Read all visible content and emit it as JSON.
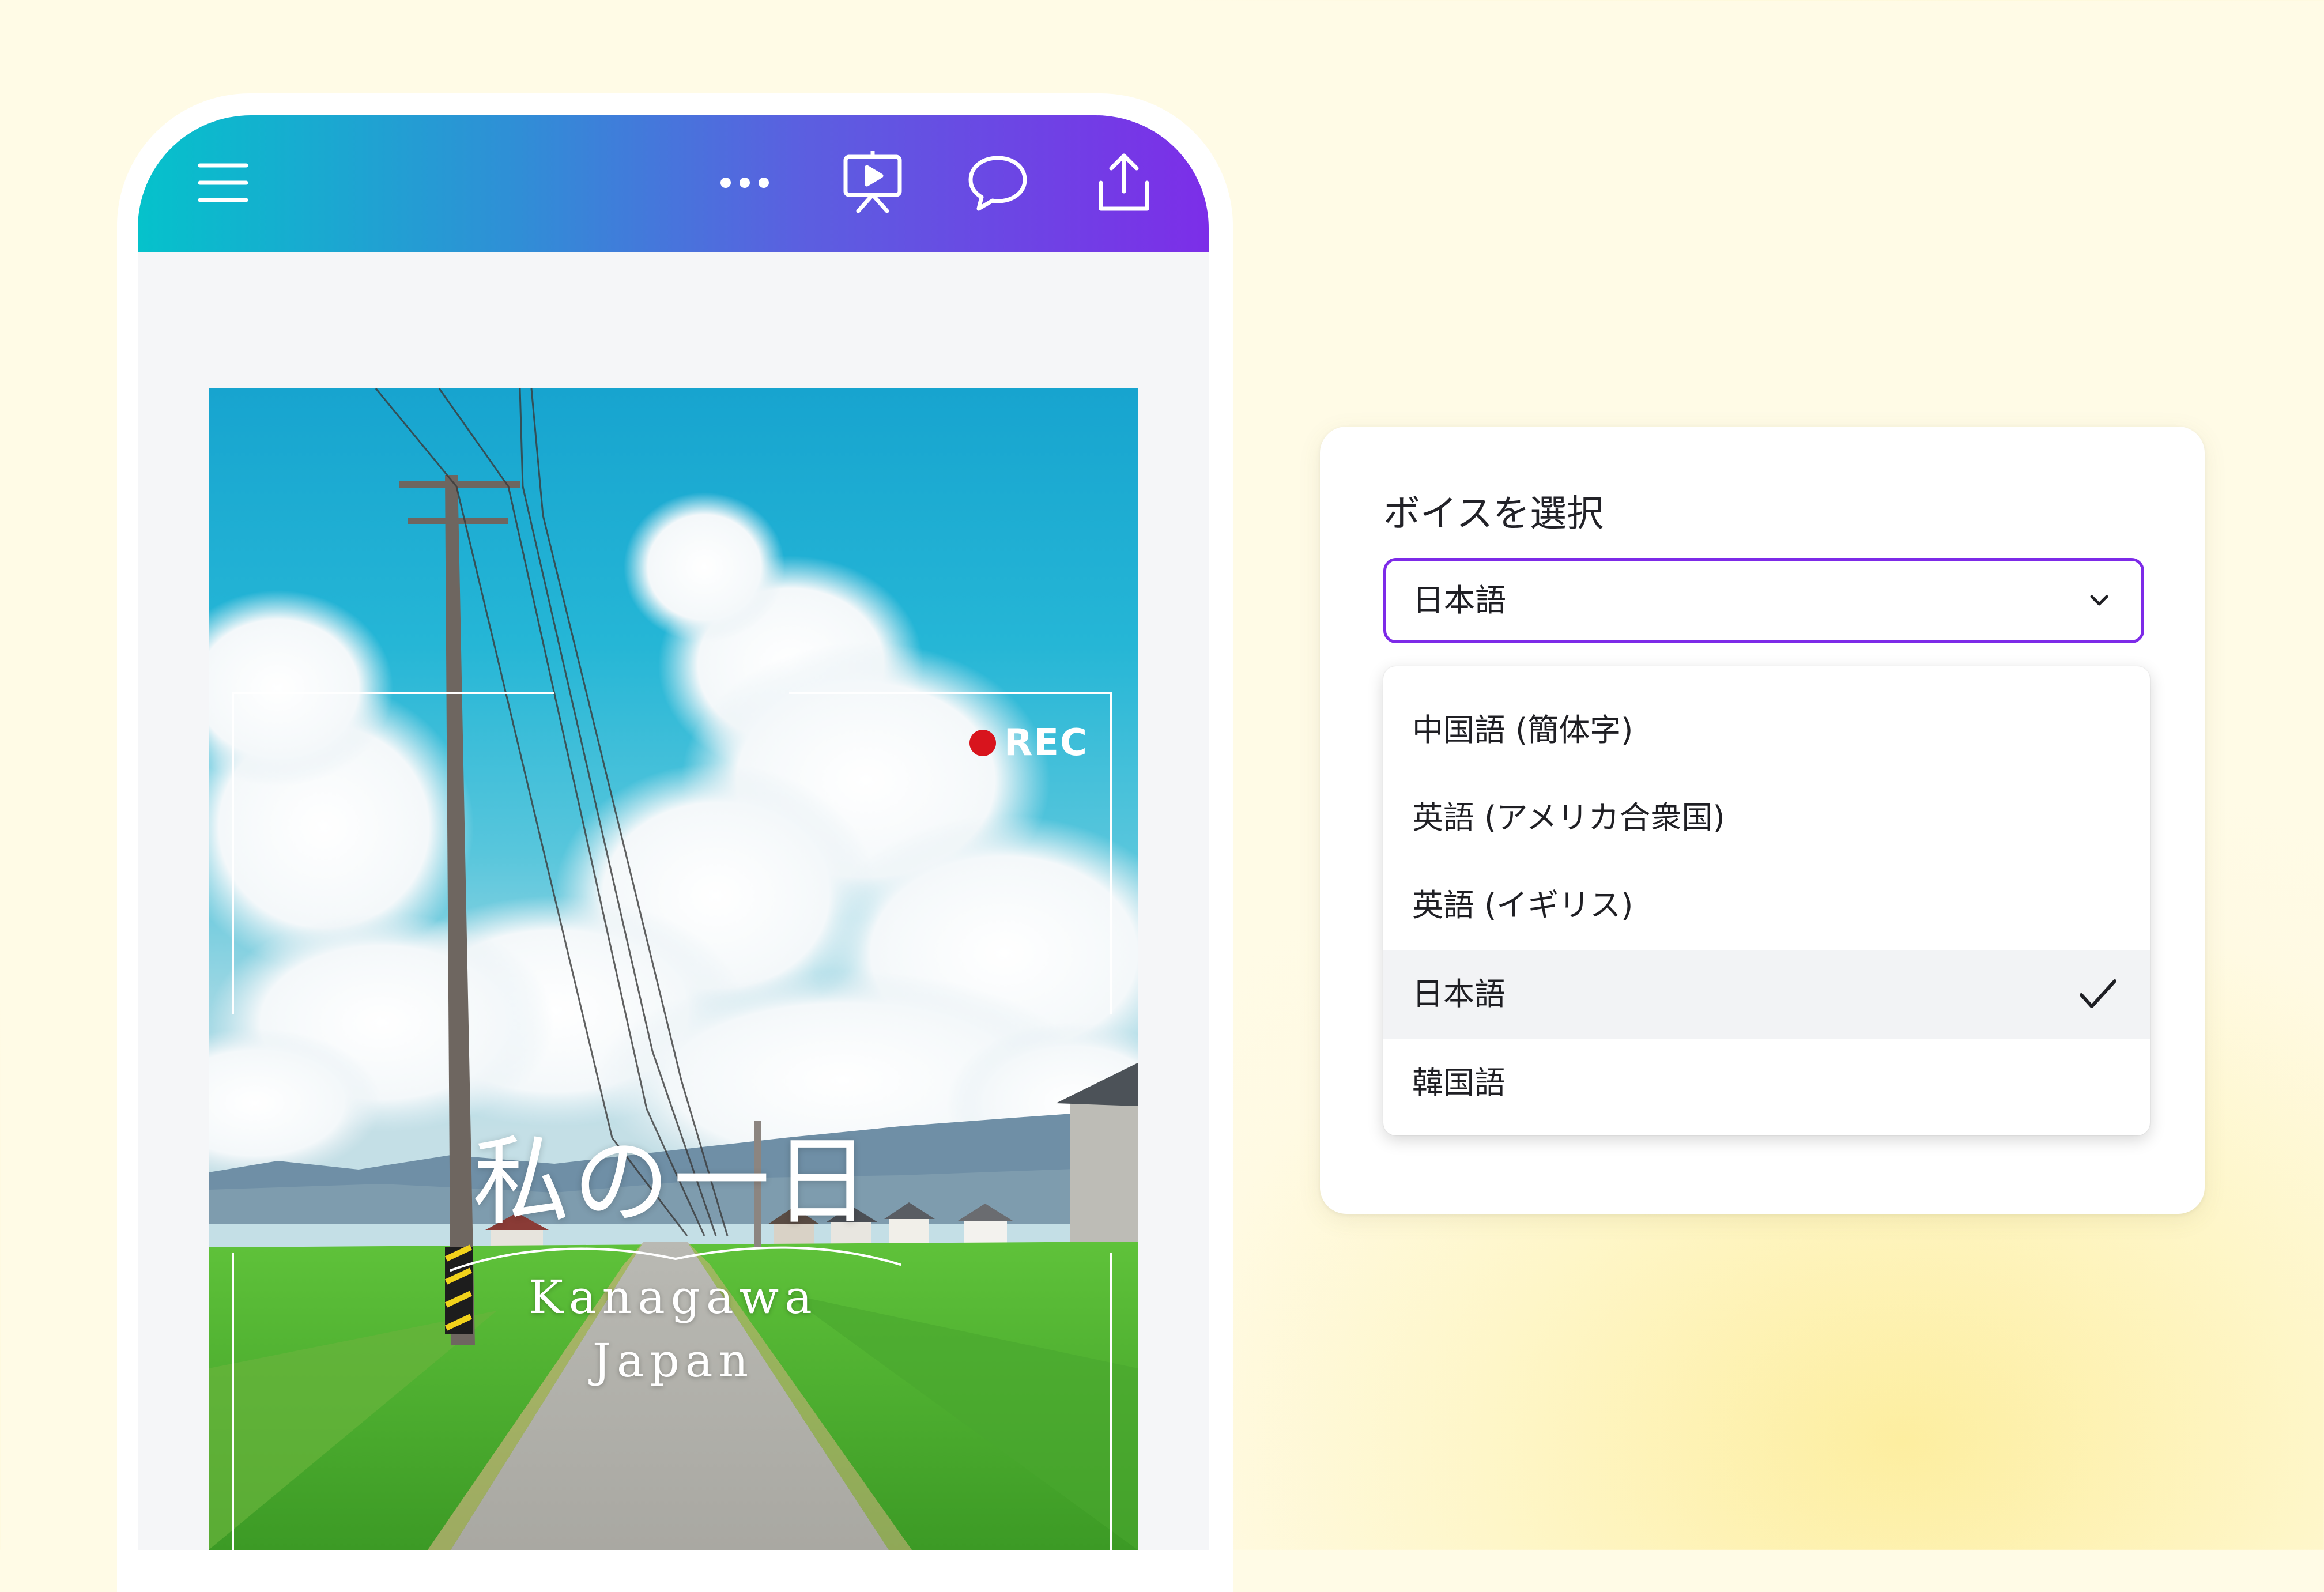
{
  "toolbar": {
    "menu_icon": "hamburger-menu-icon",
    "more_icon": "more-dots-icon",
    "present_icon": "present-icon",
    "comment_icon": "comment-icon",
    "share_icon": "share-upload-icon",
    "gradient_start": "#05c2cb",
    "gradient_end": "#7c2ee8"
  },
  "design": {
    "rec_label": "REC",
    "rec_dot_color": "#d8141d",
    "title": "私の一日",
    "subtitle_line1": "Kanagawa",
    "subtitle_line2": "Japan"
  },
  "voice_panel": {
    "title": "ボイスを選択",
    "selected_value": "日本語",
    "accent_color": "#7d2ae8",
    "options": [
      {
        "label": "中国語 (簡体字)",
        "selected": false
      },
      {
        "label": "英語 (アメリカ合衆国)",
        "selected": false
      },
      {
        "label": "英語 (イギリス)",
        "selected": false
      },
      {
        "label": "日本語",
        "selected": true
      },
      {
        "label": "韓国語",
        "selected": false
      }
    ]
  }
}
